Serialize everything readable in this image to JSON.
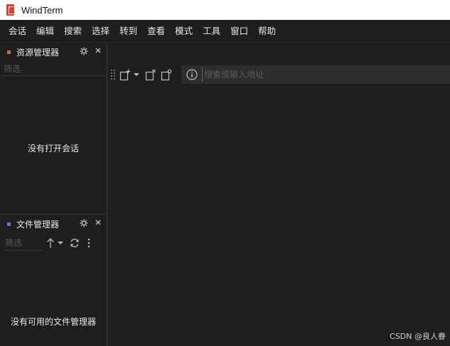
{
  "window": {
    "title": "WindTerm",
    "icon": "windterm-logo-icon"
  },
  "menu": [
    "会话",
    "编辑",
    "搜索",
    "选择",
    "转到",
    "查看",
    "模式",
    "工具",
    "窗口",
    "帮助"
  ],
  "resource_panel": {
    "title": "资源管理器",
    "marker_color": "#e0605a",
    "filter_placeholder": "筛选",
    "empty_message": "没有打开会话"
  },
  "file_panel": {
    "title": "文件管理器",
    "marker_color": "#6a70d8",
    "filter_placeholder": "筛选",
    "empty_message": "没有可用的文件管理器"
  },
  "address_bar": {
    "placeholder": "搜索或输入地址"
  },
  "watermark": "CSDN @良人眷",
  "colors": {
    "background": "#1e1e1e",
    "address_background": "#2d2d2d",
    "titlebar": "#ffffff",
    "brand": "#e23a2e"
  }
}
